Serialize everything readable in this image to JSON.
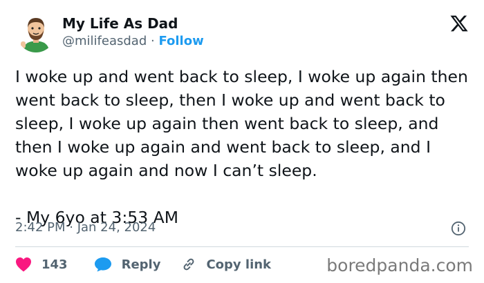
{
  "author": {
    "display_name": "My Life As Dad",
    "handle": "@milifeasdad",
    "separator": "·",
    "follow_label": "Follow"
  },
  "tweet": {
    "text": "I woke up and went back to sleep, I woke up again then went back to sleep, then I woke up and went back to sleep, I woke up again then went back to sleep, and then I woke up again and went back to sleep, and I woke up again and now I can’t sleep.\n\n- My 6yo at 3:53 AM",
    "timestamp": "2:42 PM · Jan 24, 2024"
  },
  "actions": {
    "like_count": "143",
    "reply_label": "Reply",
    "copy_link_label": "Copy link"
  },
  "watermark": "boredpanda.com",
  "colors": {
    "accent": "#1d9bf0",
    "like": "#f91880",
    "text": "#0f1419",
    "secondary": "#536471"
  }
}
